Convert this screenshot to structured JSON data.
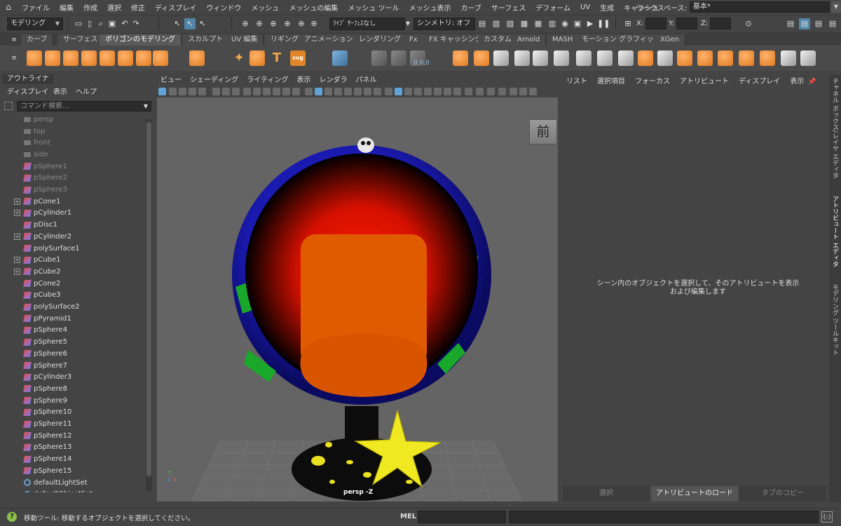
{
  "menubar": {
    "items": [
      "ファイル",
      "編集",
      "作成",
      "選択",
      "修正",
      "ディスプレイ",
      "ウィンドウ",
      "メッシュ",
      "メッシュの編集",
      "メッシュ ツール",
      "メッシュ表示",
      "カーブ",
      "サーフェス",
      "デフォーム",
      "UV",
      "生成",
      "キャッシュ"
    ],
    "workspace_label": "ワークスペース:",
    "workspace_value": "基本*"
  },
  "statusline": {
    "mode": "モデリング",
    "live_surface": "ﾗｲﾌﾞ ｻｰﾌｪｽなし",
    "symmetry": "シンメトリ: オフ",
    "x_label": "X:",
    "y_label": "Y:",
    "z_label": "Z:"
  },
  "shelf": {
    "tabs": [
      "カーブ",
      "サーフェス",
      "ポリゴンのモデリング",
      "スカルプト",
      "UV 編集",
      "リギング",
      "アニメーション",
      "レンダリング",
      "Fx",
      "FX キャッシング",
      "カスタム",
      "Arnold",
      "MASH",
      "モーション グラフィックス",
      "XGen"
    ],
    "active_tab": 2,
    "coord_readout": "0,0,0"
  },
  "outliner": {
    "title": "アウトライナ",
    "menus": [
      "ディスプレイ",
      "表示",
      "ヘルプ"
    ],
    "search_placeholder": "コマンド検索...",
    "items": [
      {
        "label": "persp",
        "type": "cam",
        "dim": true,
        "expand": false
      },
      {
        "label": "top",
        "type": "cam",
        "dim": true,
        "expand": false
      },
      {
        "label": "front",
        "type": "cam",
        "dim": true,
        "expand": false
      },
      {
        "label": "side",
        "type": "cam",
        "dim": true,
        "expand": false
      },
      {
        "label": "pSphere1",
        "type": "mesh",
        "dim": true,
        "expand": false
      },
      {
        "label": "pSphere2",
        "type": "mesh",
        "dim": true,
        "expand": false
      },
      {
        "label": "pSphere3",
        "type": "mesh",
        "dim": true,
        "expand": false
      },
      {
        "label": "pCone1",
        "type": "mesh",
        "dim": false,
        "expand": true
      },
      {
        "label": "pCylinder1",
        "type": "mesh",
        "dim": false,
        "expand": true
      },
      {
        "label": "pDisc1",
        "type": "mesh",
        "dim": false,
        "expand": false
      },
      {
        "label": "pCylinder2",
        "type": "mesh",
        "dim": false,
        "expand": true
      },
      {
        "label": "polySurface1",
        "type": "mesh",
        "dim": false,
        "expand": false
      },
      {
        "label": "pCube1",
        "type": "mesh",
        "dim": false,
        "expand": true
      },
      {
        "label": "pCube2",
        "type": "mesh",
        "dim": false,
        "expand": true
      },
      {
        "label": "pCone2",
        "type": "mesh",
        "dim": false,
        "expand": false
      },
      {
        "label": "pCube3",
        "type": "mesh",
        "dim": false,
        "expand": false
      },
      {
        "label": "polySurface2",
        "type": "mesh",
        "dim": false,
        "expand": false
      },
      {
        "label": "pPyramid1",
        "type": "mesh",
        "dim": false,
        "expand": false
      },
      {
        "label": "pSphere4",
        "type": "mesh",
        "dim": false,
        "expand": false
      },
      {
        "label": "pSphere5",
        "type": "mesh",
        "dim": false,
        "expand": false
      },
      {
        "label": "pSphere6",
        "type": "mesh",
        "dim": false,
        "expand": false
      },
      {
        "label": "pSphere7",
        "type": "mesh",
        "dim": false,
        "expand": false
      },
      {
        "label": "pCylinder3",
        "type": "mesh",
        "dim": false,
        "expand": false
      },
      {
        "label": "pSphere8",
        "type": "mesh",
        "dim": false,
        "expand": false
      },
      {
        "label": "pSphere9",
        "type": "mesh",
        "dim": false,
        "expand": false
      },
      {
        "label": "pSphere10",
        "type": "mesh",
        "dim": false,
        "expand": false
      },
      {
        "label": "pSphere11",
        "type": "mesh",
        "dim": false,
        "expand": false
      },
      {
        "label": "pSphere12",
        "type": "mesh",
        "dim": false,
        "expand": false
      },
      {
        "label": "pSphere13",
        "type": "mesh",
        "dim": false,
        "expand": false
      },
      {
        "label": "pSphere14",
        "type": "mesh",
        "dim": false,
        "expand": false
      },
      {
        "label": "pSphere15",
        "type": "mesh",
        "dim": false,
        "expand": false
      },
      {
        "label": "defaultLightSet",
        "type": "set",
        "dim": false,
        "expand": false
      },
      {
        "label": "defaultObjectSet",
        "type": "set",
        "dim": false,
        "expand": false
      }
    ]
  },
  "viewport": {
    "menus": [
      "ビュー",
      "シェーディング",
      "ライティング",
      "表示",
      "レンダラ",
      "パネル"
    ],
    "viewcube_label": "前",
    "camera_label": "persp -Z",
    "colors": {
      "shell_outer": "#1a1aa8",
      "shell_inner": "#ff2a00",
      "seat": "#e05a00",
      "stand": "#0c0c0c",
      "star": "#f0e820",
      "dots": "#e8e020",
      "green": "#1aa82a"
    }
  },
  "attribute_editor": {
    "menus": [
      "リスト",
      "選択項目",
      "フォーカス",
      "アトリビュート",
      "ディスプレイ",
      "表示"
    ],
    "message": "シーン内のオブジェクトを選択して、そのアトリビュートを表示および編集します",
    "buttons": [
      "選択",
      "アトリビュートのロード",
      "タブのコピー"
    ]
  },
  "side_tabs": [
    "チャネル ボックス/レイヤ エディタ",
    "アトリビュート エディタ",
    "モデリング ツールキット"
  ],
  "helpline": {
    "message": "移動ツール: 移動するオブジェクトを選択してください。",
    "mel_label": "MEL"
  }
}
